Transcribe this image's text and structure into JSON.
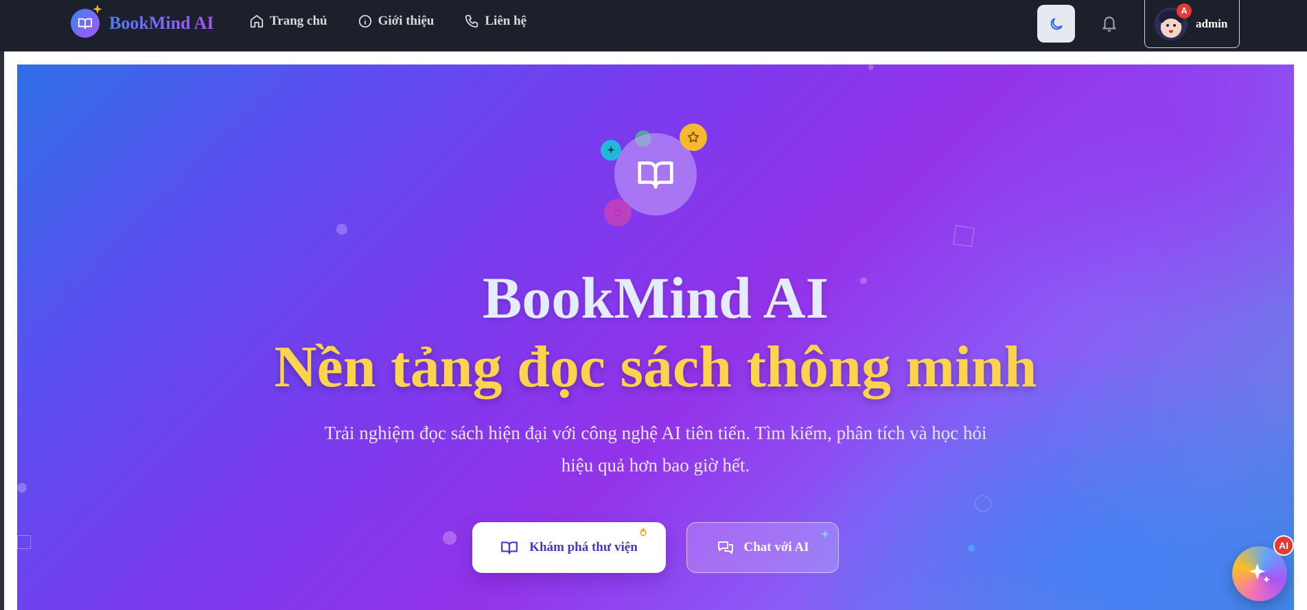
{
  "brand": {
    "name": "BookMind AI",
    "logo_icon": "open-book-icon"
  },
  "nav": {
    "items": [
      {
        "label": "Trang chủ",
        "icon": "home-icon"
      },
      {
        "label": "Giới thiệu",
        "icon": "info-icon"
      },
      {
        "label": "Liên hệ",
        "icon": "phone-icon"
      }
    ]
  },
  "header": {
    "theme_icon": "moon-icon",
    "notification_icon": "bell-icon",
    "user": {
      "name": "admin",
      "badge": "A"
    }
  },
  "hero": {
    "title": "BookMind AI",
    "subtitle": "Nền tảng đọc sách thông minh",
    "description": "Trải nghiệm đọc sách hiện đại với công nghệ AI tiên tiến. Tìm kiếm, phân tích và học hỏi hiệu quả hơn bao giờ hết.",
    "primary_button": "Khám phá thư viện",
    "secondary_button": "Chat với AI"
  },
  "ai_fab": {
    "badge": "AI"
  },
  "colors": {
    "nav_bg": "#1b202b",
    "accent_yellow": "#fcd34d",
    "primary_indigo": "#4338ca",
    "hero_purple": "#9333ea",
    "hero_blue": "#2f6fe6"
  }
}
